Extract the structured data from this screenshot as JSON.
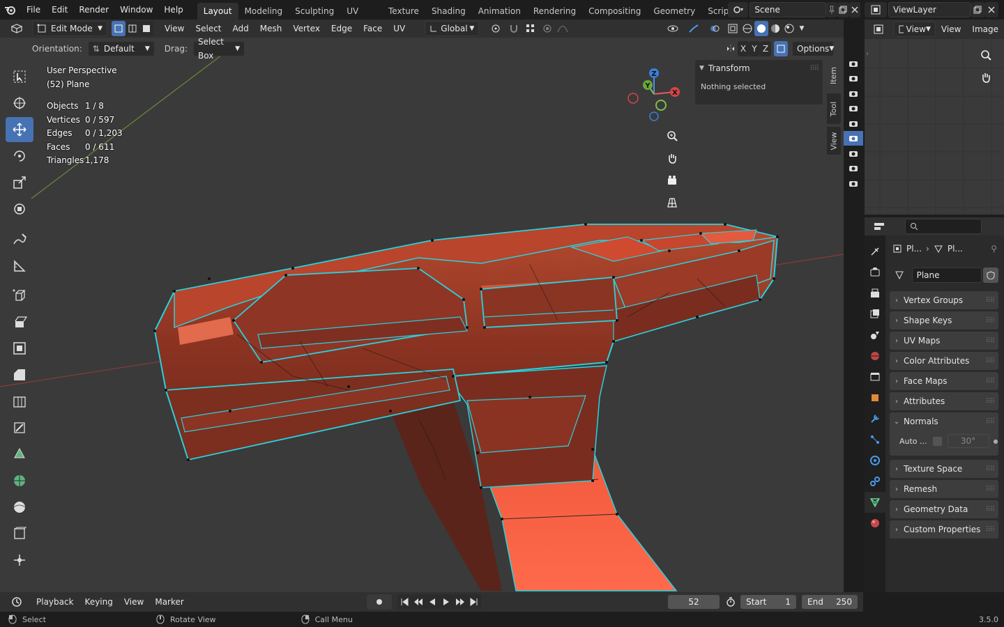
{
  "menu": {
    "items": [
      "File",
      "Edit",
      "Render",
      "Window",
      "Help"
    ]
  },
  "workspaces": [
    "Layout",
    "Modeling",
    "Sculpting",
    "UV Editing",
    "Texture Paint",
    "Shading",
    "Animation",
    "Rendering",
    "Compositing",
    "Geometry Nodes",
    "Scripting"
  ],
  "active_workspace": "Layout",
  "scene_name": "Scene",
  "view_layer_name": "ViewLayer",
  "viewport_header": {
    "mode": "Edit Mode",
    "menus": [
      "View",
      "Select",
      "Add",
      "Mesh",
      "Vertex",
      "Edge",
      "Face",
      "UV"
    ],
    "transform_orientation": "Global"
  },
  "tool_settings": {
    "orientation_label": "Orientation:",
    "orientation_value": "Default",
    "drag_label": "Drag:",
    "drag_value": "Select Box",
    "axes": [
      "X",
      "Y",
      "Z"
    ],
    "options_label": "Options"
  },
  "overlay": {
    "view_name": "User Perspective",
    "object_name": "(52) Plane",
    "stats": [
      {
        "label": "Objects",
        "value": "1 / 8"
      },
      {
        "label": "Vertices",
        "value": "0 / 597"
      },
      {
        "label": "Edges",
        "value": "0 / 1,203"
      },
      {
        "label": "Faces",
        "value": "0 / 611"
      },
      {
        "label": "Triangles",
        "value": "1,178"
      }
    ]
  },
  "npanel": {
    "section_title": "Transform",
    "message": "Nothing selected",
    "tabs": [
      "Item",
      "Tool",
      "View"
    ]
  },
  "gizmo_axes": {
    "x": "X",
    "y": "Y",
    "z": "Z"
  },
  "right_view": {
    "menus": [
      "View",
      "Image"
    ],
    "view_dropdown": "View"
  },
  "properties": {
    "breadcrumb_1": "Pl...",
    "breadcrumb_2": "Pl...",
    "datablock_name": "Plane",
    "panels": [
      "Vertex Groups",
      "Shape Keys",
      "UV Maps",
      "Color Attributes",
      "Face Maps",
      "Attributes"
    ],
    "normals": {
      "title": "Normals",
      "auto_smooth_label": "Auto ...",
      "angle": "30°"
    },
    "panels_after": [
      "Texture Space",
      "Remesh",
      "Geometry Data",
      "Custom Properties"
    ]
  },
  "timeline": {
    "menus": [
      "Playback",
      "Keying",
      "View",
      "Marker"
    ],
    "current_frame": "52",
    "start_label": "Start",
    "start_value": "1",
    "end_label": "End",
    "end_value": "250"
  },
  "statusbar": {
    "select": "Select",
    "rotate": "Rotate View",
    "call_menu": "Call Menu",
    "version": "3.5.0"
  },
  "colors": {
    "accent": "#4772b3",
    "mesh_face": "#a83a22",
    "mesh_edge": "#27d3e0",
    "background": "#3a3a3a"
  }
}
